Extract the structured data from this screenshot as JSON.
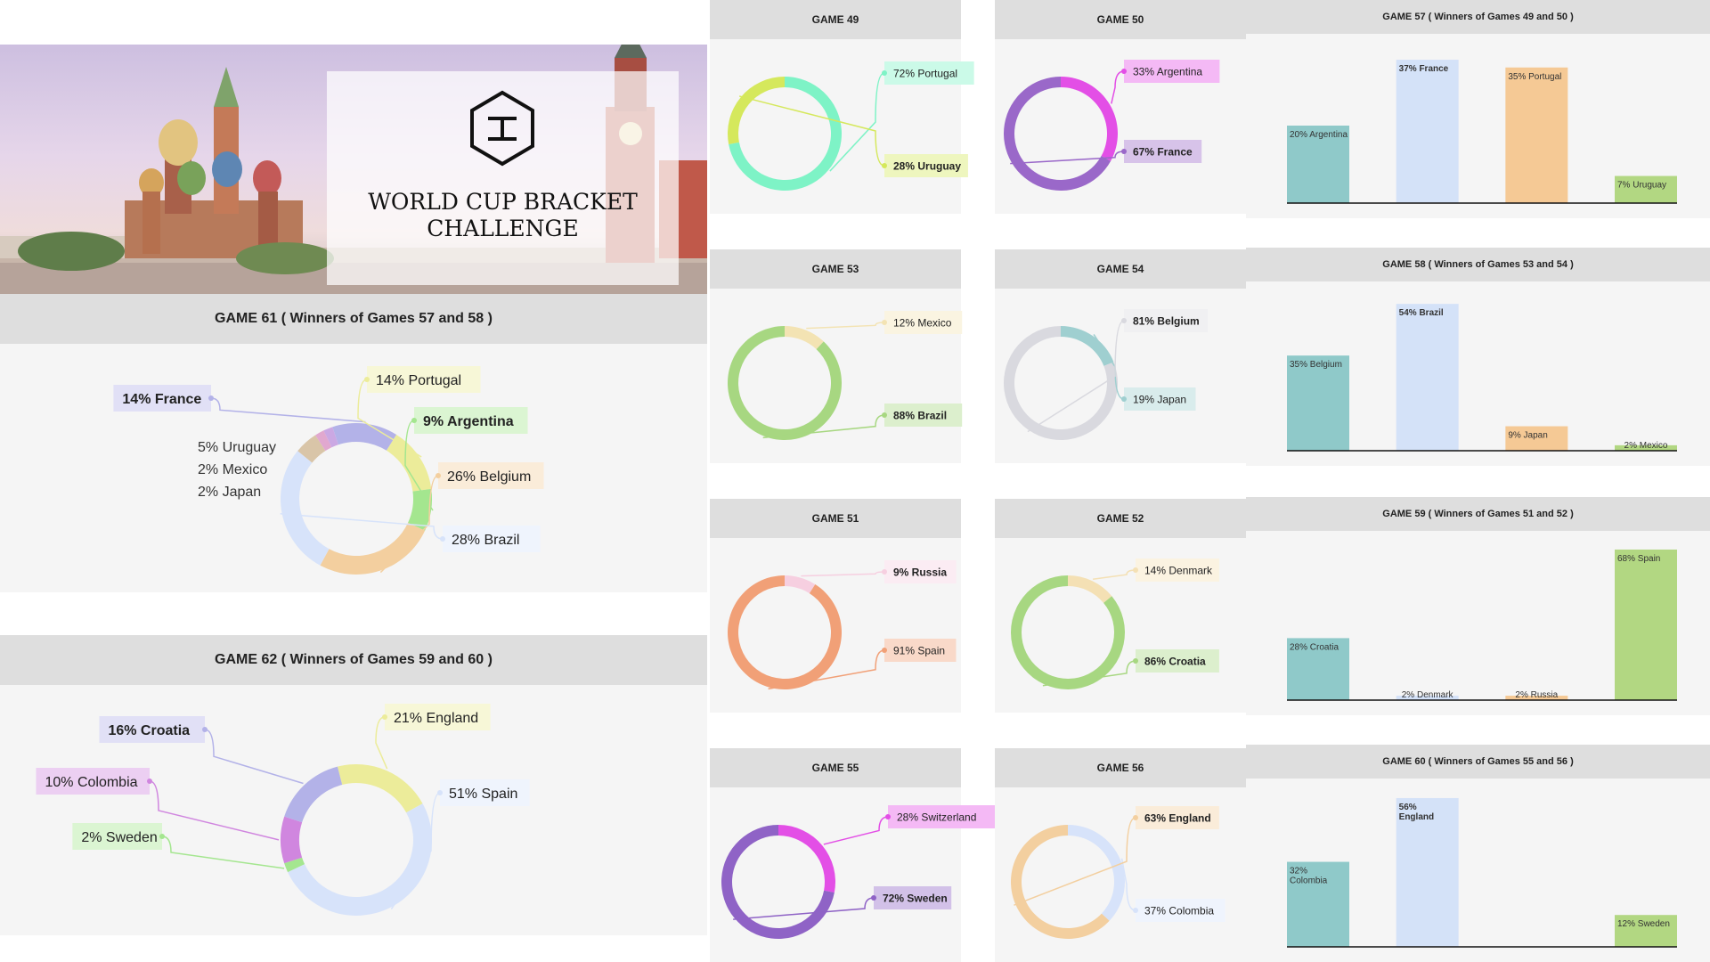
{
  "hero": {
    "title_line1": "WORLD CUP BRACKET",
    "title_line2": "CHALLENGE",
    "logo_icon": "hexagon-i-logo-icon"
  },
  "colors": {
    "header_bg": "#dedede",
    "panel_bg": "#f5f5f5",
    "teal": "#8fc9c9",
    "lightblue": "#d4e2f8",
    "peach": "#f5c995",
    "green": "#b2d782",
    "purple": "#8f63c6",
    "magenta": "#e34fe6"
  },
  "chart_data": [
    {
      "id": "game61",
      "type": "pie",
      "donut": true,
      "title": "GAME 61 ( Winners of Games 57 and 58 )",
      "slices": [
        {
          "label": "14% France",
          "value": 14,
          "color": "#b3b2e8"
        },
        {
          "label": "14% Portugal",
          "value": 14,
          "color": "#ecec9a"
        },
        {
          "label": "9% Argentina",
          "value": 9,
          "color": "#a4e68f"
        },
        {
          "label": "26% Belgium",
          "value": 26,
          "color": "#f3cf9f"
        },
        {
          "label": "28% Brazil",
          "value": 28,
          "color": "#d7e3fa"
        },
        {
          "label": "5% Uruguay",
          "value": 5,
          "color": "#d9c5a8"
        },
        {
          "label": "2% Mexico",
          "value": 2,
          "color": "#e1a8cf"
        },
        {
          "label": "2% Japan",
          "value": 2,
          "color": "#cba8e3"
        }
      ],
      "extra_labels": [
        "5% Uruguay",
        "2% Mexico",
        "2% Japan"
      ]
    },
    {
      "id": "game62",
      "type": "pie",
      "donut": true,
      "title": "GAME 62 ( Winners of Games 59 and 60 )",
      "slices": [
        {
          "label": "21% England",
          "value": 21,
          "color": "#ecec9a"
        },
        {
          "label": "51% Spain",
          "value": 51,
          "color": "#d7e3fa"
        },
        {
          "label": "2% Sweden",
          "value": 2,
          "color": "#a4e68f"
        },
        {
          "label": "10% Colombia",
          "value": 10,
          "color": "#d086df"
        },
        {
          "label": "16% Croatia",
          "value": 16,
          "color": "#b3b2e8"
        }
      ]
    },
    {
      "id": "game49",
      "type": "pie",
      "donut": true,
      "title": "GAME 49",
      "slices": [
        {
          "label": "72% Portugal",
          "value": 72,
          "color": "#7ef3c6"
        },
        {
          "label": "28% Uruguay",
          "value": 28,
          "color": "#d5e85c"
        }
      ]
    },
    {
      "id": "game50",
      "type": "pie",
      "donut": true,
      "title": "GAME 50",
      "slices": [
        {
          "label": "33% Argentina",
          "value": 33,
          "color": "#e34fe6"
        },
        {
          "label": "67% France",
          "value": 67,
          "color": "#9a68c9"
        }
      ]
    },
    {
      "id": "game53",
      "type": "pie",
      "donut": true,
      "title": "GAME 53",
      "slices": [
        {
          "label": "12% Mexico",
          "value": 12,
          "color": "#f3e3b3"
        },
        {
          "label": "88% Brazil",
          "value": 88,
          "color": "#a7d781"
        }
      ]
    },
    {
      "id": "game54",
      "type": "pie",
      "donut": true,
      "title": "GAME 54",
      "slices": [
        {
          "label": "19% Japan",
          "value": 19,
          "color": "#9fcfd0"
        },
        {
          "label": "81% Belgium",
          "value": 81,
          "color": "#d9d9df"
        }
      ]
    },
    {
      "id": "game51",
      "type": "pie",
      "donut": true,
      "title": "GAME 51",
      "slices": [
        {
          "label": "9% Russia",
          "value": 9,
          "color": "#f6cfe0"
        },
        {
          "label": "91% Spain",
          "value": 91,
          "color": "#f1a077"
        }
      ]
    },
    {
      "id": "game52",
      "type": "pie",
      "donut": true,
      "title": "GAME 52",
      "slices": [
        {
          "label": "14% Denmark",
          "value": 14,
          "color": "#f4e0b4"
        },
        {
          "label": "86% Croatia",
          "value": 86,
          "color": "#a7d781"
        }
      ]
    },
    {
      "id": "game55",
      "type": "pie",
      "donut": true,
      "title": "GAME 55",
      "slices": [
        {
          "label": "28% Switzerland",
          "value": 28,
          "color": "#e34fe6"
        },
        {
          "label": "72% Sweden",
          "value": 72,
          "color": "#8f63c6"
        }
      ]
    },
    {
      "id": "game56",
      "type": "pie",
      "donut": true,
      "title": "GAME 56",
      "slices": [
        {
          "label": "37% Colombia",
          "value": 37,
          "color": "#d7e3fa"
        },
        {
          "label": "63% England",
          "value": 63,
          "color": "#f3cf9f"
        }
      ]
    },
    {
      "id": "game57",
      "type": "bar",
      "title": "GAME 57 ( Winners of Games 49 and 50 )",
      "categories": [
        "Argentina",
        "France",
        "Portugal",
        "Uruguay"
      ],
      "values": [
        20,
        37,
        35,
        7
      ],
      "labels": [
        "20% Argentina",
        "37% France",
        "35% Portugal",
        "7% Uruguay"
      ],
      "ylim": [
        0,
        40
      ]
    },
    {
      "id": "game58",
      "type": "bar",
      "title": "GAME 58 ( Winners of Games 53 and 54 )",
      "categories": [
        "Belgium",
        "Brazil",
        "Japan",
        "Mexico"
      ],
      "values": [
        35,
        54,
        9,
        2
      ],
      "labels": [
        "35% Belgium",
        "54% Brazil",
        "9% Japan",
        "2% Mexico"
      ],
      "ylim": [
        0,
        57
      ]
    },
    {
      "id": "game59",
      "type": "bar",
      "title": "GAME 59 ( Winners of Games 51 and 52 )",
      "categories": [
        "Croatia",
        "Denmark",
        "Russia",
        "Spain"
      ],
      "values": [
        28,
        2,
        2,
        68
      ],
      "labels": [
        "28% Croatia",
        "2% Denmark",
        "2% Russia",
        "68% Spain"
      ],
      "ylim": [
        0,
        70
      ]
    },
    {
      "id": "game60",
      "type": "bar",
      "title": "GAME 60 ( Winners of Games 55 and 56 )",
      "categories": [
        "Colombia",
        "England",
        "",
        "Sweden"
      ],
      "values": [
        32,
        56,
        0,
        12
      ],
      "labels": [
        "32% Colombia",
        "56% England",
        "",
        "12% Sweden"
      ],
      "ylim": [
        0,
        58
      ]
    }
  ]
}
